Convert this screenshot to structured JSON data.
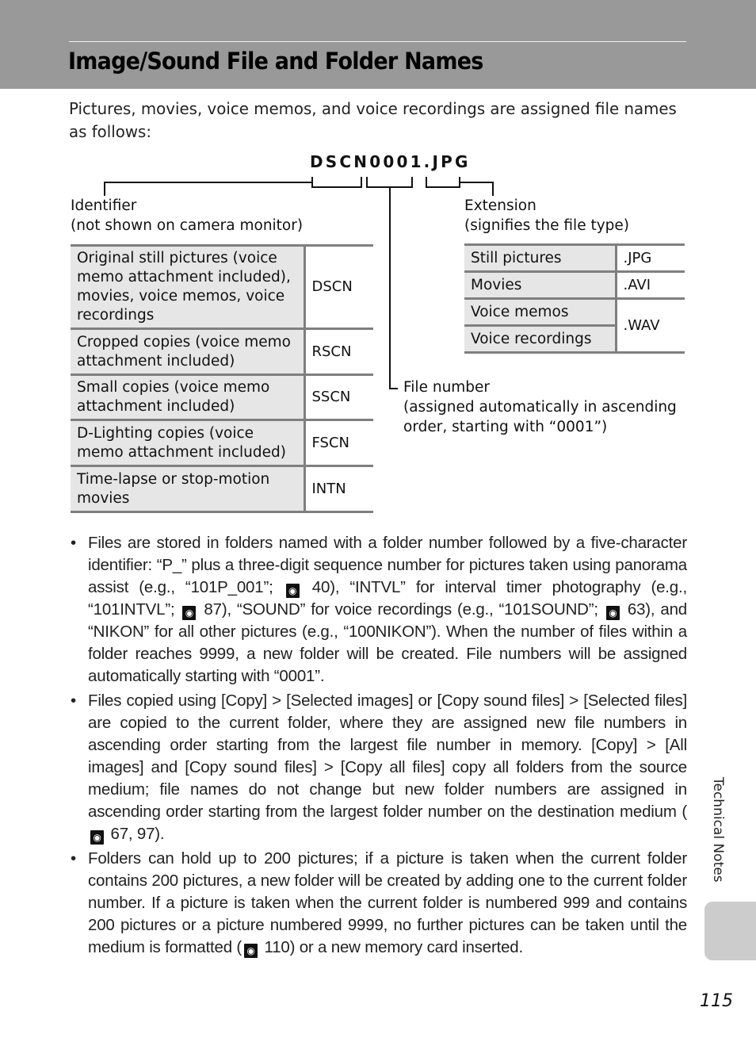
{
  "header": {
    "title": "Image/Sound File and Folder Names"
  },
  "intro": "Pictures, movies, voice memos, and voice recordings are assigned file names as follows:",
  "diagram": {
    "example_filename": "DSCN0001.JPG",
    "identifier_label": {
      "title": "Identifier",
      "note": "(not shown on camera monitor)"
    },
    "extension_label": {
      "title": "Extension",
      "note": "(signifies the file type)"
    },
    "file_number_label": {
      "title": "File number",
      "note_line1": "(assigned automatically in ascending",
      "note_line2": "order, starting with “0001”)"
    },
    "identifier_table": [
      {
        "description": "Original still pictures (voice memo attachment included), movies, voice memos, voice recordings",
        "code": "DSCN"
      },
      {
        "description": "Cropped copies (voice memo attachment included)",
        "code": "RSCN"
      },
      {
        "description": "Small copies (voice memo attachment included)",
        "code": "SSCN"
      },
      {
        "description": "D-Lighting copies (voice memo attachment included)",
        "code": "FSCN"
      },
      {
        "description": "Time-lapse or stop-motion movies",
        "code": "INTN"
      }
    ],
    "extension_table": [
      {
        "description": "Still pictures",
        "code": ".JPG"
      },
      {
        "description": "Movies",
        "code": ".AVI"
      },
      {
        "description": "Voice memos",
        "code": ".WAV"
      },
      {
        "description": "Voice recordings",
        "code": ".WAV"
      }
    ]
  },
  "bullets": [
    {
      "parts": [
        "Files are stored in folders named with a folder number followed by a five-character identifier: “P_” plus a three-digit sequence number for pictures taken using panorama assist (e.g., “101P_001”; ",
        " 40), “INTVL” for interval timer photography (e.g., “101INTVL”; ",
        " 87), “SOUND” for voice recordings (e.g., “101SOUND”; ",
        " 63), and “NIKON” for all other pictures (e.g., “100NIKON”). When the number of files within a folder reaches 9999, a new folder will be created. File numbers will be assigned automatically starting with “0001”."
      ]
    },
    {
      "parts": [
        "Files copied using [Copy] > [Selected images] or [Copy sound files] > [Selected files] are copied to the current folder, where they are assigned new file numbers in ascending order starting from the largest file number in memory. [Copy] > [All images] and [Copy sound files] > [Copy all files] copy all folders from the source medium; file names do not change but new folder numbers are assigned in ascending order starting from the largest folder number on the destination medium (",
        " 67, 97)."
      ]
    },
    {
      "parts": [
        "Folders can hold up to 200 pictures; if a picture is taken when the current folder contains 200 pictures, a new folder will be created by adding one to the current folder number. If a picture is taken when the current folder is numbered 999 and contains 200 pictures or a picture numbered 9999, no further pictures can be taken until the medium is formatted (",
        " 110) or a new memory card inserted."
      ]
    }
  ],
  "icons": {
    "reference": "page-reference-eye-icon",
    "bullet": "•",
    "reference_glyph": "◉"
  },
  "sidebar": {
    "section_label": "Technical Notes"
  },
  "footer": {
    "page_number": "115"
  }
}
